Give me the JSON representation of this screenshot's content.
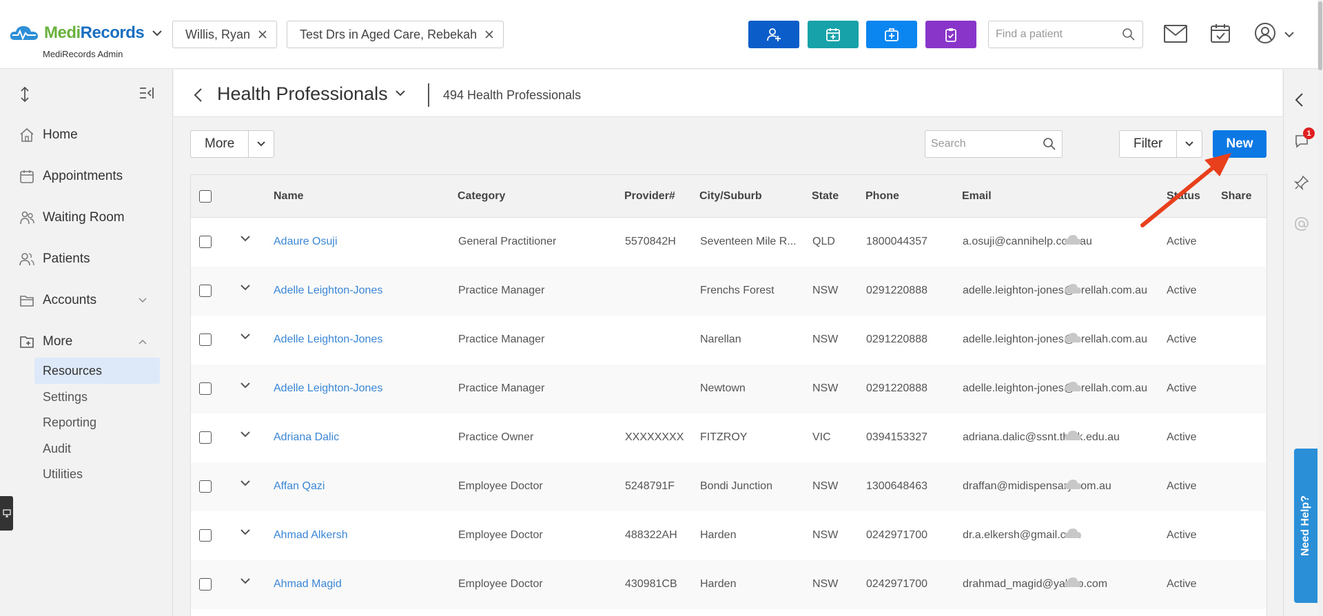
{
  "app": {
    "name_part1": "Medi",
    "name_part2": "Records",
    "subtitle": "MediRecords Admin"
  },
  "patient_tabs": [
    {
      "label": "Willis, Ryan"
    },
    {
      "label": "Test Drs in Aged Care, Rebekah"
    }
  ],
  "quick_actions": [
    {
      "icon": "add-person-icon",
      "color": "#0b5ec9"
    },
    {
      "icon": "calendar-plus-icon",
      "color": "#17a1a8"
    },
    {
      "icon": "medical-kit-icon",
      "color": "#0b85f0"
    },
    {
      "icon": "clipboard-check-icon",
      "color": "#8a35c9"
    }
  ],
  "find_patient": {
    "placeholder": "Find a patient"
  },
  "sidebar": {
    "items": [
      {
        "label": "Home",
        "icon": "home-icon"
      },
      {
        "label": "Appointments",
        "icon": "calendar-icon"
      },
      {
        "label": "Waiting Room",
        "icon": "waiting-room-icon"
      },
      {
        "label": "Patients",
        "icon": "patients-icon"
      },
      {
        "label": "Accounts",
        "icon": "folder-icon"
      },
      {
        "label": "More",
        "icon": "folder-plus-icon"
      }
    ],
    "sub_items": [
      {
        "label": "Resources",
        "active": true
      },
      {
        "label": "Settings"
      },
      {
        "label": "Reporting"
      },
      {
        "label": "Audit"
      },
      {
        "label": "Utilities"
      }
    ]
  },
  "header": {
    "title": "Health Professionals",
    "count": "494 Health Professionals"
  },
  "toolbar": {
    "more_label": "More",
    "search_placeholder": "Search",
    "filter_label": "Filter",
    "new_label": "New"
  },
  "table": {
    "columns": [
      "Name",
      "Category",
      "Provider#",
      "City/Suburb",
      "State",
      "Phone",
      "Email",
      "Status",
      "Share"
    ],
    "rows": [
      {
        "name": "Adaure Osuji",
        "category": "General Practitioner",
        "provider": "5570842H",
        "city": "Seventeen Mile R...",
        "state": "QLD",
        "phone": "1800044357",
        "email": "a.osuji@cannihelp.com.au",
        "status": "Active"
      },
      {
        "name": "Adelle Leighton-Jones",
        "category": "Practice Manager",
        "provider": "",
        "city": "Frenchs Forest",
        "state": "NSW",
        "phone": "0291220888",
        "email": "adelle.leighton-jones@brellah.com.au",
        "status": "Active"
      },
      {
        "name": "Adelle Leighton-Jones",
        "category": "Practice Manager",
        "provider": "",
        "city": "Narellan",
        "state": "NSW",
        "phone": "0291220888",
        "email": "adelle.leighton-jones@brellah.com.au",
        "status": "Active"
      },
      {
        "name": "Adelle Leighton-Jones",
        "category": "Practice Manager",
        "provider": "",
        "city": "Newtown",
        "state": "NSW",
        "phone": "0291220888",
        "email": "adelle.leighton-jones@brellah.com.au",
        "status": "Active"
      },
      {
        "name": "Adriana Dalic",
        "category": "Practice Owner",
        "provider": "XXXXXXXX",
        "city": "FITZROY",
        "state": "VIC",
        "phone": "0394153327",
        "email": "adriana.dalic@ssnt.think.edu.au",
        "status": "Active"
      },
      {
        "name": "Affan Qazi",
        "category": "Employee Doctor",
        "provider": "5248791F",
        "city": "Bondi Junction",
        "state": "NSW",
        "phone": "1300648463",
        "email": "draffan@midispensary.com.au",
        "status": "Active"
      },
      {
        "name": "Ahmad Alkersh",
        "category": "Employee Doctor",
        "provider": "488322AH",
        "city": "Harden",
        "state": "NSW",
        "phone": "0242971700",
        "email": "dr.a.elkersh@gmail.com",
        "status": "Active"
      },
      {
        "name": "Ahmad Magid",
        "category": "Employee Doctor",
        "provider": "430981CB",
        "city": "Harden",
        "state": "NSW",
        "phone": "0242971700",
        "email": "drahmad_magid@yahoo.com",
        "status": "Active"
      }
    ]
  },
  "right_rail": {
    "notification_count": "1",
    "need_help_label": "Need Help?"
  },
  "colors": {
    "accent": "#0b78e3",
    "link": "#3a86d6",
    "annotation_arrow": "#e8401c"
  }
}
